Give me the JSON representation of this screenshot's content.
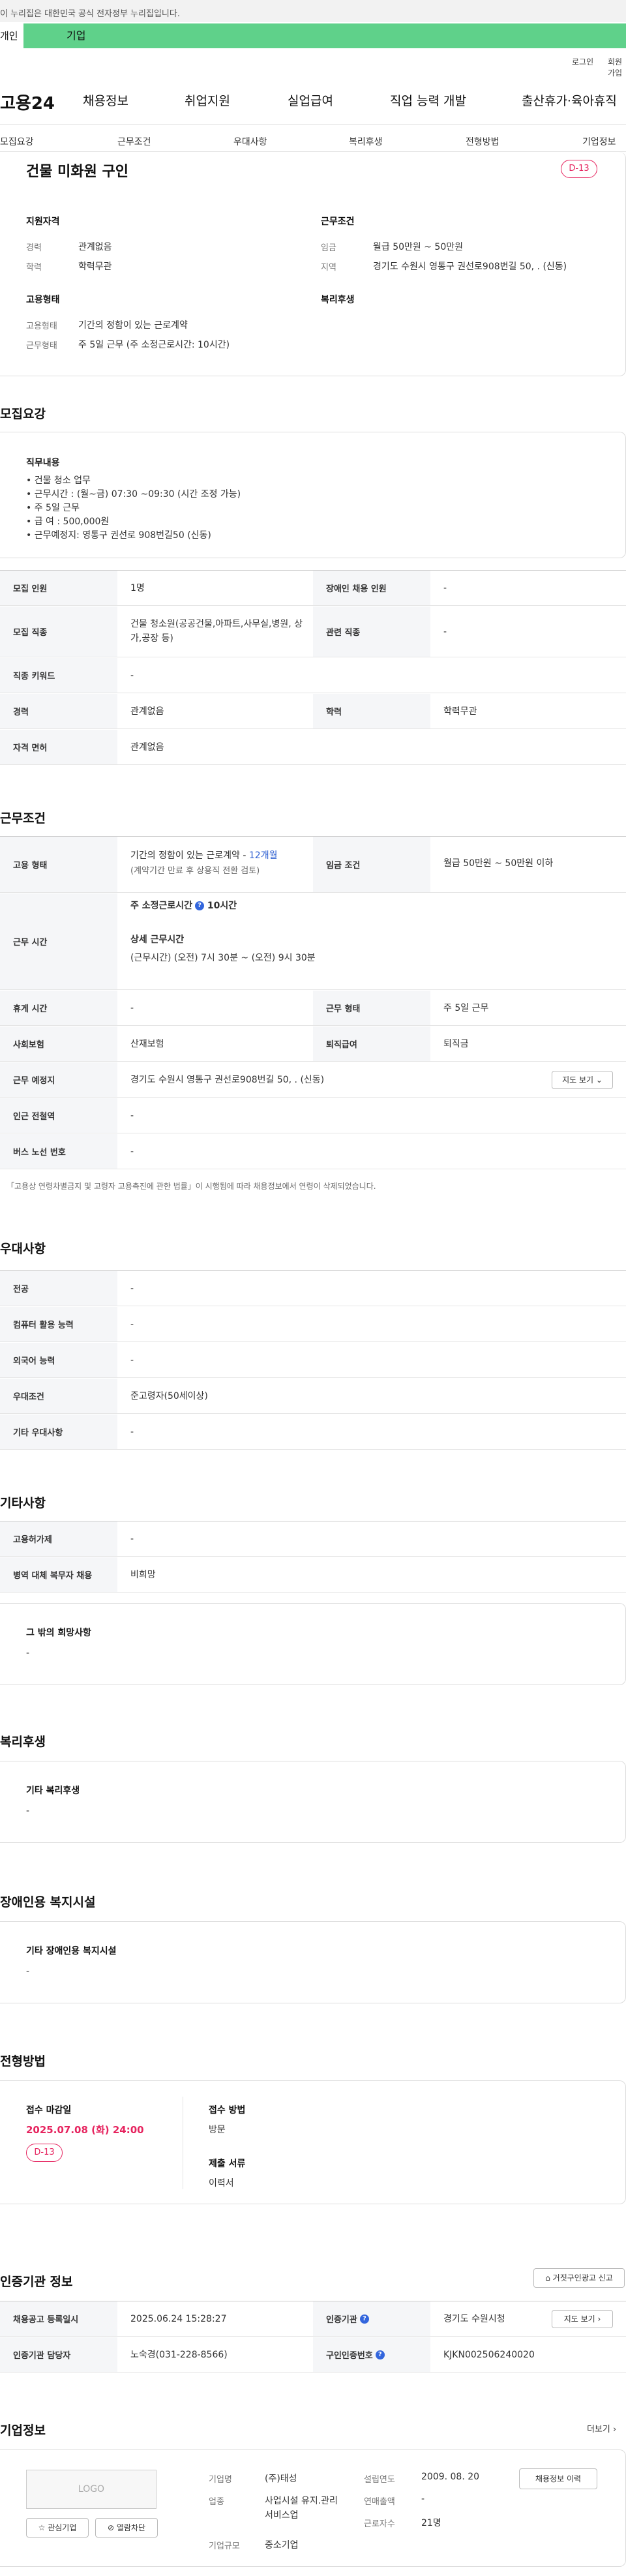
{
  "gov_banner": {
    "text": "이 누리집은 대한민국 공식 전자정부 누리집입니다."
  },
  "tabs_top": {
    "personal": "개인",
    "company": "기업"
  },
  "util": {
    "login": "로그인",
    "join": "회원가입"
  },
  "brand": {
    "logo": "고용24"
  },
  "gnb": [
    "채용정보",
    "취업지원",
    "실업급여",
    "직업 능력 개발",
    "출산휴가·육아휴직"
  ],
  "section_tabs": [
    "모집요강",
    "근무조건",
    "우대사항",
    "복리후생",
    "전형방법",
    "기업정보"
  ],
  "summary": {
    "title": "건물 미화원 구인",
    "dday": "D-13",
    "qual_title": "지원자격",
    "career_label": "경력",
    "career": "관계없음",
    "edu_label": "학력",
    "edu": "학력무관",
    "cond_title": "근무조건",
    "wage_label": "임금",
    "wage": "월급 50만원 ~ 50만원",
    "area_label": "지역",
    "area": "경기도 수원시 영통구 권선로908번길 50, . (신동)",
    "emp_title": "고용형태",
    "emp_label": "고용형태",
    "emp": "기간의 정함이 있는 근로계약",
    "work_label": "근무형태",
    "work": "주 5일 근무 (주 소정근로시간: 10시간)",
    "welfare_title": "복리후생"
  },
  "recruit": {
    "heading": "모집요강",
    "job_desc_title": "직무내용",
    "job_desc": [
      "• 건물 청소 업무",
      "• 근무시간 : (월~금) 07:30 ~09:30 (시간 조정 가능)",
      "• 주 5일 근무",
      "• 급  여 : 500,000원",
      "• 근무예정지: 영통구 권선로 908번길50 (신동)"
    ],
    "count_label": "모집 인원",
    "count": "1명",
    "disabled_label": "장애인 채용 인원",
    "disabled": "-",
    "jobtype_label": "모집 직종",
    "jobtype": "건물 청소원(공공건물,아파트,사무실,병원, 상가,공장 등)",
    "related_label": "관련 직종",
    "related": "-",
    "keyword_label": "직종 키워드",
    "keyword": "-",
    "career_label": "경력",
    "career": "관계없음",
    "edu_label": "학력",
    "edu": "학력무관",
    "license_label": "자격 면허",
    "license": "관계없음"
  },
  "conditions": {
    "heading": "근무조건",
    "emp_label": "고용 형태",
    "emp": "기간의 정함이 있는 근로계약 - ",
    "emp_period": "12개월",
    "emp_note": "(계약기간 만료 후 상용직 전환 검토)",
    "wage_label": "임금 조건",
    "wage": "월급 50만원 ~ 50만원 이하",
    "hours_label": "근무 시간",
    "hours_week": "주 소정근로시간",
    "hours_week_val": "10시간",
    "hours_detail_title": "상세 근무시간",
    "hours_detail": "(근무시간) (오전) 7시 30분 ~ (오전) 9시 30분",
    "break_label": "휴게 시간",
    "break": "-",
    "worktype_label": "근무 형태",
    "worktype": "주 5일 근무",
    "insurance_label": "사회보험",
    "insurance": "산재보험",
    "severance_label": "퇴직급여",
    "severance": "퇴직금",
    "place_label": "근무 예정지",
    "place": "경기도 수원시 영통구 권선로908번길 50, . (신동)",
    "map_btn": "지도 보기",
    "subway_label": "인근 전철역",
    "subway": "-",
    "bus_label": "버스 노선 번호",
    "bus": "-",
    "notice": "「고용상 연령차별금지 및 고령자 고용촉진에 관한 법률」이 시행됨에 따라 채용정보에서 연령이 삭제되었습니다."
  },
  "preference": {
    "heading": "우대사항",
    "rows": [
      [
        "전공",
        "-"
      ],
      [
        "컴퓨터 활용 능력",
        "-"
      ],
      [
        "외국어 능력",
        "-"
      ],
      [
        "우대조건",
        "준고령자(50세이상)"
      ],
      [
        "기타 우대사항",
        "-"
      ]
    ]
  },
  "etc": {
    "heading": "기타사항",
    "rows": [
      [
        "고용허가제",
        "-"
      ],
      [
        "병역 대체 복무자 채용",
        "비희망"
      ]
    ],
    "wish_title": "그 밖의 희망사항",
    "wish": "-"
  },
  "welfare": {
    "heading": "복리후생",
    "title": "기타 복리후생",
    "value": "-"
  },
  "facility": {
    "heading": "장애인용 복지시설",
    "title": "기타 장애인용 복지시설",
    "value": "-"
  },
  "selection": {
    "heading": "전형방법",
    "deadline_title": "접수 마감일",
    "deadline": "2025.07.08 (화) 24:00",
    "dday": "D-13",
    "method_title": "접수 방법",
    "method": "방문",
    "docs_title": "제출 서류",
    "docs": "이력서"
  },
  "agency": {
    "heading": "인증기관 정보",
    "report_btn": "거짓구인광고 신고",
    "reg_label": "채용공고 등록일시",
    "reg": "2025.06.24 15:28:27",
    "org_label": "인증기관",
    "org": "경기도 수원시청",
    "map_btn": "지도 보기",
    "manager_label": "인증기관 담당자",
    "manager": "노숙경(031-228-8566)",
    "number_label": "구인인증번호",
    "number": "KJKN002506240020"
  },
  "company": {
    "heading": "기업정보",
    "more": "더보기",
    "logo": "LOGO",
    "fav_btn": "관심기업",
    "block_btn": "열람차단",
    "name_label": "기업명",
    "name": "(주)태성",
    "year_label": "설립연도",
    "year": "2009. 08. 20",
    "history_btn": "채용정보 이력",
    "biz_label": "업종",
    "biz": "사업시설 유지.관리 서비스업",
    "sales_label": "연매출액",
    "sales": "-",
    "size_label": "기업규모",
    "size": "중소기업",
    "staff_label": "근로자수",
    "staff": "21명"
  },
  "colors": {
    "accent_green": "#5fd18a",
    "dday_red": "#e6245f",
    "link_blue": "#2a5cd1",
    "table_header": "#f5f6f8"
  }
}
